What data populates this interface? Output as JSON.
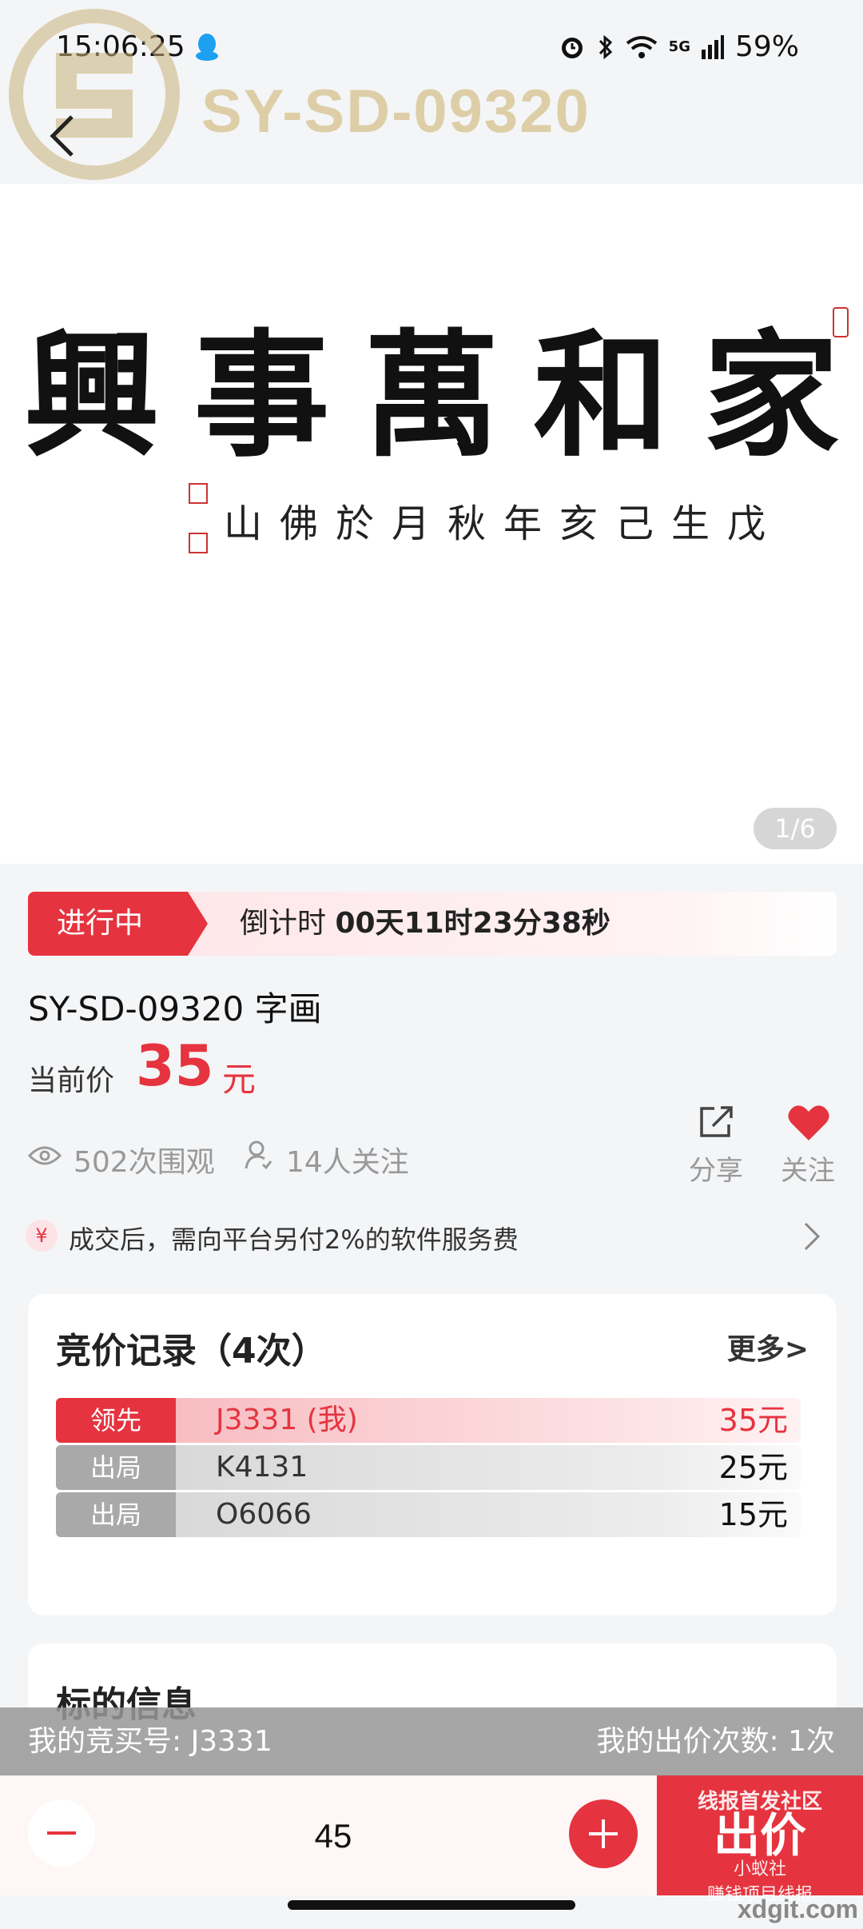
{
  "status_bar": {
    "time": "15:06:25",
    "network": "5G",
    "battery": "59%",
    "icons": [
      "qq-icon",
      "alarm-icon",
      "bluetooth-icon",
      "wifi-icon",
      "signal-icon"
    ]
  },
  "watermark": {
    "code": "SY-SD-09320",
    "site": "xdgit.com",
    "badge_lines": [
      "线报首发社区",
      "小蚁社",
      "赚钱项目线报"
    ]
  },
  "gallery": {
    "page_indicator": "1/6"
  },
  "auction": {
    "status": "进行中",
    "countdown_prefix": "倒计时",
    "countdown": "00天11时23分38秒",
    "title": "SY-SD-09320 字画",
    "price_label": "当前价",
    "price_value": "35",
    "price_unit": "元",
    "views": "502次围观",
    "followers": "14人关注",
    "share_label": "分享",
    "follow_label": "关注",
    "fee_notice": "成交后，需向平台另付2%的软件服务费",
    "fee_icon": "¥"
  },
  "bid_records": {
    "title": "竞价记录（4次）",
    "more_label": "更多>",
    "rows": [
      {
        "tag": "领先",
        "user": "J3331 (我)",
        "amount": "35元"
      },
      {
        "tag": "出局",
        "user": "K4131",
        "amount": "25元"
      },
      {
        "tag": "出局",
        "user": "O6066",
        "amount": "15元"
      }
    ]
  },
  "lot_info": {
    "title": "标的信息"
  },
  "my_bidding": {
    "bidder_no": "我的竞买号: J3331",
    "bid_count": "我的出价次数: 1次",
    "input_value": "45",
    "submit_label": "出价"
  },
  "colors": {
    "accent": "#e5343f",
    "gray_tag": "#a9a9a9",
    "background": "#f4f5f7"
  }
}
